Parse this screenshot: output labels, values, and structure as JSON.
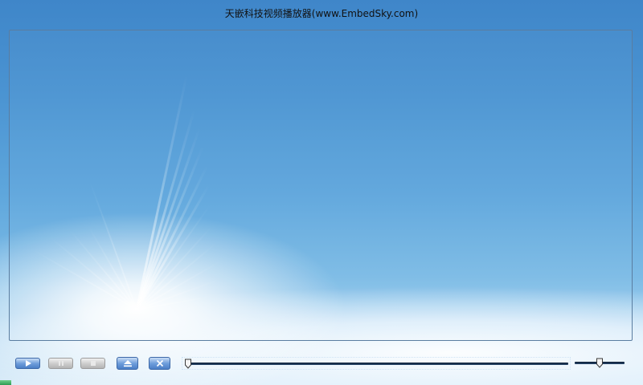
{
  "window": {
    "title": "天嵌科技视频播放器(www.EmbedSky.com)"
  },
  "controls": {
    "buttons": [
      {
        "name": "play-button",
        "icon": "play-icon",
        "enabled": true
      },
      {
        "name": "pause-button",
        "icon": "pause-icon",
        "enabled": false
      },
      {
        "name": "stop-button",
        "icon": "stop-icon",
        "enabled": false
      },
      {
        "name": "open-file-button",
        "icon": "eject-icon",
        "enabled": true
      },
      {
        "name": "close-button",
        "icon": "close-icon",
        "enabled": true
      }
    ],
    "progress": {
      "value": 0.0
    },
    "volume": {
      "value": 0.5
    }
  },
  "colors": {
    "accent_blue": "#4b7fc6",
    "disabled_grey": "#b4b4b4",
    "track": "#0c1d33"
  }
}
